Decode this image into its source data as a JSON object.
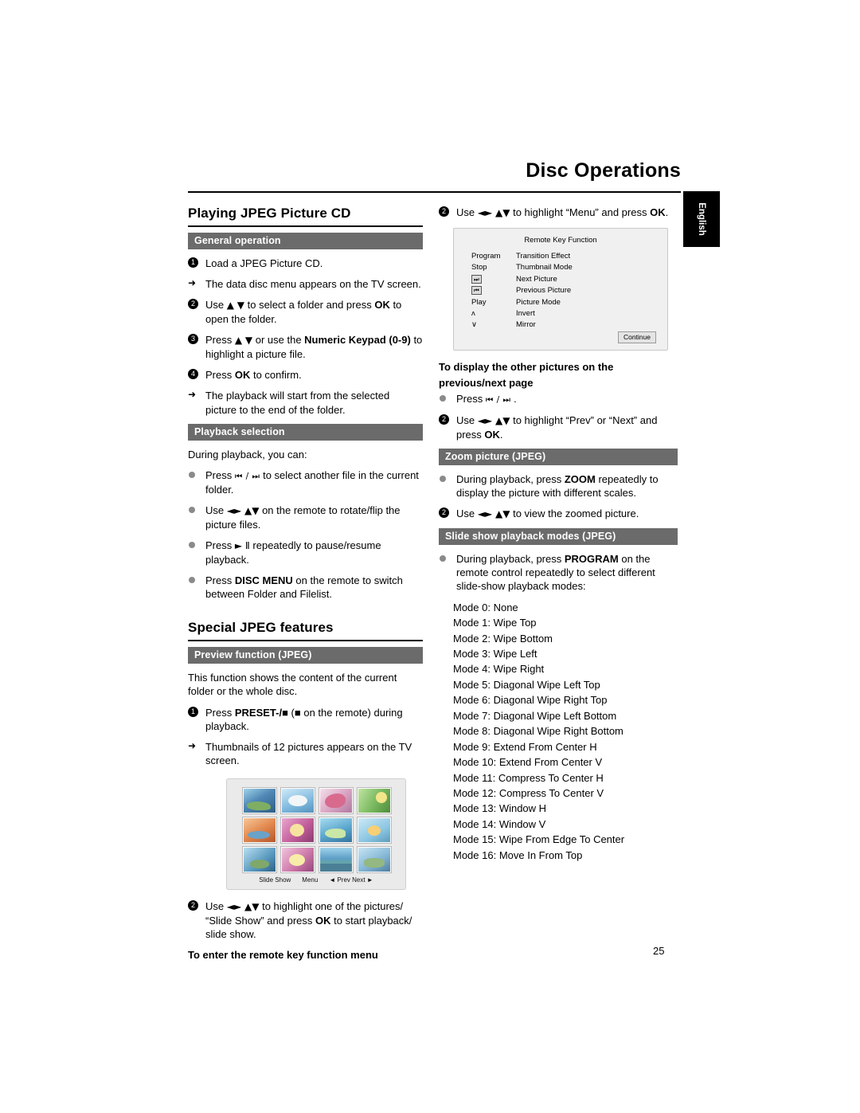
{
  "header": {
    "title": "Disc Operations",
    "lang_tab": "English",
    "page_number": "25"
  },
  "left_column": {
    "section1_title": "Playing JPEG Picture CD",
    "general_operation_head": "General operation",
    "general_steps": [
      {
        "num": "1",
        "text": "Load a JPEG Picture CD."
      },
      {
        "arrow": true,
        "text": "The data disc menu appears on the TV screen."
      },
      {
        "num": "2",
        "text_pre": "Use ",
        "glyph": "▲ ▼",
        "text_post": " to select a folder and press ",
        "bold": "OK",
        "text_end": " to open the folder."
      },
      {
        "num": "3",
        "text_pre": "Press ",
        "glyph": "▲ ▼",
        "text_post": " or use the ",
        "bold": "Numeric Keypad (0-9)",
        "text_end": " to highlight a picture file."
      },
      {
        "num": "4",
        "text_pre": "Press ",
        "bold": "OK",
        "text_end": " to confirm."
      },
      {
        "arrow": true,
        "text": "The playback will start from the selected picture to the end of the folder."
      }
    ],
    "playback_selection_head": "Playback selection",
    "playback_intro": "During playback, you can:",
    "playback_items": [
      {
        "text_pre": "Press ",
        "glyph": "⏮ / ⏭",
        "text_post": " to select another file in the current folder."
      },
      {
        "text_pre": "Use ",
        "glyph": "◄► ▲▼",
        "text_post": " on the remote to rotate/flip the picture files."
      },
      {
        "text_pre": "Press  ",
        "glyph": "► Ⅱ",
        "text_post": " repeatedly to pause/resume playback."
      },
      {
        "text_pre": "Press ",
        "bold": "DISC MENU",
        "text_post": " on the remote to switch between Folder and Filelist."
      }
    ],
    "section2_title": "Special JPEG features",
    "preview_head": "Preview function (JPEG)",
    "preview_intro": "This function shows the content of the current folder or the whole disc.",
    "preview_steps": [
      {
        "num": "1",
        "text_pre": "Press ",
        "bold": "PRESET-/■",
        "text_post": " (■ on the remote) during playback."
      },
      {
        "arrow": true,
        "text": "Thumbnails of 12 pictures appears on the TV screen."
      }
    ],
    "thumbnail_bar": [
      "Slide Show",
      "Menu",
      "◄ Prev  Next ►"
    ],
    "final_step": {
      "num": "2",
      "text_pre": "Use ",
      "glyph": "◄► ▲▼",
      "text_post": "  to highlight one of the pictures/ “Slide Show” and press ",
      "bold": "OK",
      "text_end": " to start playback/ slide show."
    },
    "remote_menu_note": "To enter the remote key function menu"
  },
  "right_column": {
    "step_menu": {
      "num": "2",
      "text_pre": "Use ",
      "glyph": "◄► ▲▼",
      "text_post": " to highlight “Menu” and press ",
      "bold": "OK",
      "text_end": "."
    },
    "remote_key_box": {
      "title": "Remote Key Function",
      "continue_label": "Continue",
      "rows": [
        {
          "key": "Program",
          "func": "Transition Effect",
          "glyph": false
        },
        {
          "key": "Stop",
          "func": "Thumbnail Mode",
          "glyph": false
        },
        {
          "key": "⏭",
          "func": "Next Picture",
          "glyph": true
        },
        {
          "key": "⏮",
          "func": "Previous Picture",
          "glyph": true
        },
        {
          "key": "Play",
          "func": "Picture Mode",
          "glyph": false
        },
        {
          "key": "ʌ",
          "func": "Invert",
          "glyph": false
        },
        {
          "key": "∨",
          "func": "Mirror",
          "glyph": false
        }
      ]
    },
    "other_pictures_head_line1": "To display the other pictures on the",
    "other_pictures_head_line2": "previous/next page",
    "other_pictures_items": [
      {
        "text_pre": "Press ",
        "glyph": "⏮ / ⏭",
        "text_post": " ."
      },
      {
        "num": "2",
        "text_pre": "Use ",
        "glyph": "◄► ▲▼",
        "text_post": " to highlight “Prev” or “Next” and press ",
        "bold": "OK",
        "text_end": "."
      }
    ],
    "zoom_head": "Zoom picture (JPEG)",
    "zoom_items": [
      {
        "text_pre": "During playback, press ",
        "bold": "ZOOM",
        "text_post": " repeatedly to display the picture with different scales."
      },
      {
        "num": "2",
        "text_pre": "Use ",
        "glyph": "◄► ▲▼",
        "text_post": " to view the zoomed picture."
      }
    ],
    "slideshow_head": "Slide show playback modes (JPEG)",
    "slideshow_item": {
      "text_pre": "During playback, press ",
      "bold": "PROGRAM",
      "text_post": " on the remote control repeatedly to select different slide-show playback modes:"
    },
    "modes": [
      "Mode 0: None",
      "Mode 1: Wipe Top",
      "Mode 2: Wipe Bottom",
      "Mode 3: Wipe Left",
      "Mode 4: Wipe Right",
      "Mode 5: Diagonal Wipe Left Top",
      "Mode 6: Diagonal Wipe Right Top",
      "Mode 7: Diagonal Wipe Left Bottom",
      "Mode 8: Diagonal Wipe Right Bottom",
      "Mode 9: Extend From Center H",
      "Mode 10: Extend From Center V",
      "Mode 11: Compress To Center H",
      "Mode 12: Compress To Center V",
      "Mode 13: Window H",
      "Mode 14: Window V",
      "Mode 15: Wipe From Edge To Center",
      "Mode 16: Move In From Top"
    ]
  }
}
